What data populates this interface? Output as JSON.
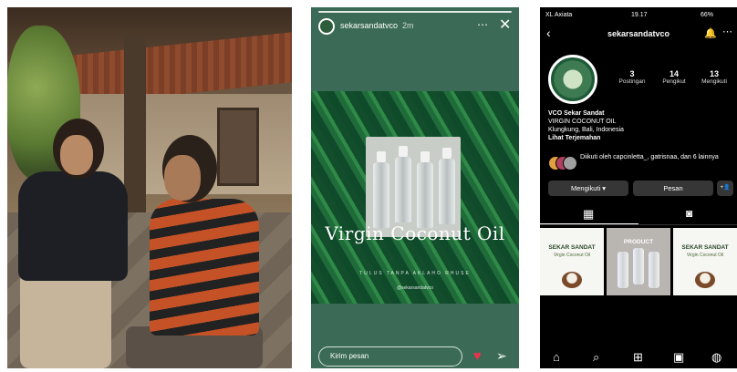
{
  "story": {
    "username": "sekarsandatvco",
    "time": "2m",
    "more_icon": "⋯",
    "close_icon": "✕",
    "product_title": "Virgin Coconut Oil",
    "tagline": "TULUS TANPA AKLAHO RHUSE",
    "handle_small": "@sekarsandatvco",
    "reply_placeholder": "Kirim pesan",
    "heart_icon": "♥",
    "send_icon": "➢"
  },
  "profile": {
    "status_bar": {
      "carrier": "XL Axiata",
      "time": "19.17",
      "battery": "66%"
    },
    "back_icon": "‹",
    "username": "sekarsandatvco",
    "bell_icon": "🔔",
    "more_icon": "⋯",
    "stats": [
      {
        "num": "3",
        "label": "Postingan"
      },
      {
        "num": "14",
        "label": "Pengikut"
      },
      {
        "num": "13",
        "label": "Mengikuti"
      }
    ],
    "bio": {
      "name": "VCO Sekar Sandat",
      "line1": "VIRGIN COCONUT OIL",
      "line2": "Klungkung, Bali, Indonesia",
      "translate": "Lihat Terjemahan"
    },
    "followed_by": "Diikuti oleh capcinletta_, gatrisnaa, dan 6 lainnya",
    "buttons": {
      "following": "Mengikuti ▾",
      "message": "Pesan",
      "add_user": "+👤"
    },
    "tabs": {
      "grid_icon": "▦",
      "tagged_icon": "◙"
    },
    "grid": [
      {
        "title": "SEKAR SANDAT",
        "subtitle": "Virgin Coconut Oil"
      },
      {
        "title": "PRODUCT",
        "subtitle": ""
      },
      {
        "title": "SEKAR SANDAT",
        "subtitle": "Virgin Coconut Oil"
      }
    ],
    "nav": {
      "home_icon": "⌂",
      "search_icon": "⌕",
      "add_icon": "⊞",
      "shop_icon": "▣",
      "profile_icon": "◍"
    }
  }
}
